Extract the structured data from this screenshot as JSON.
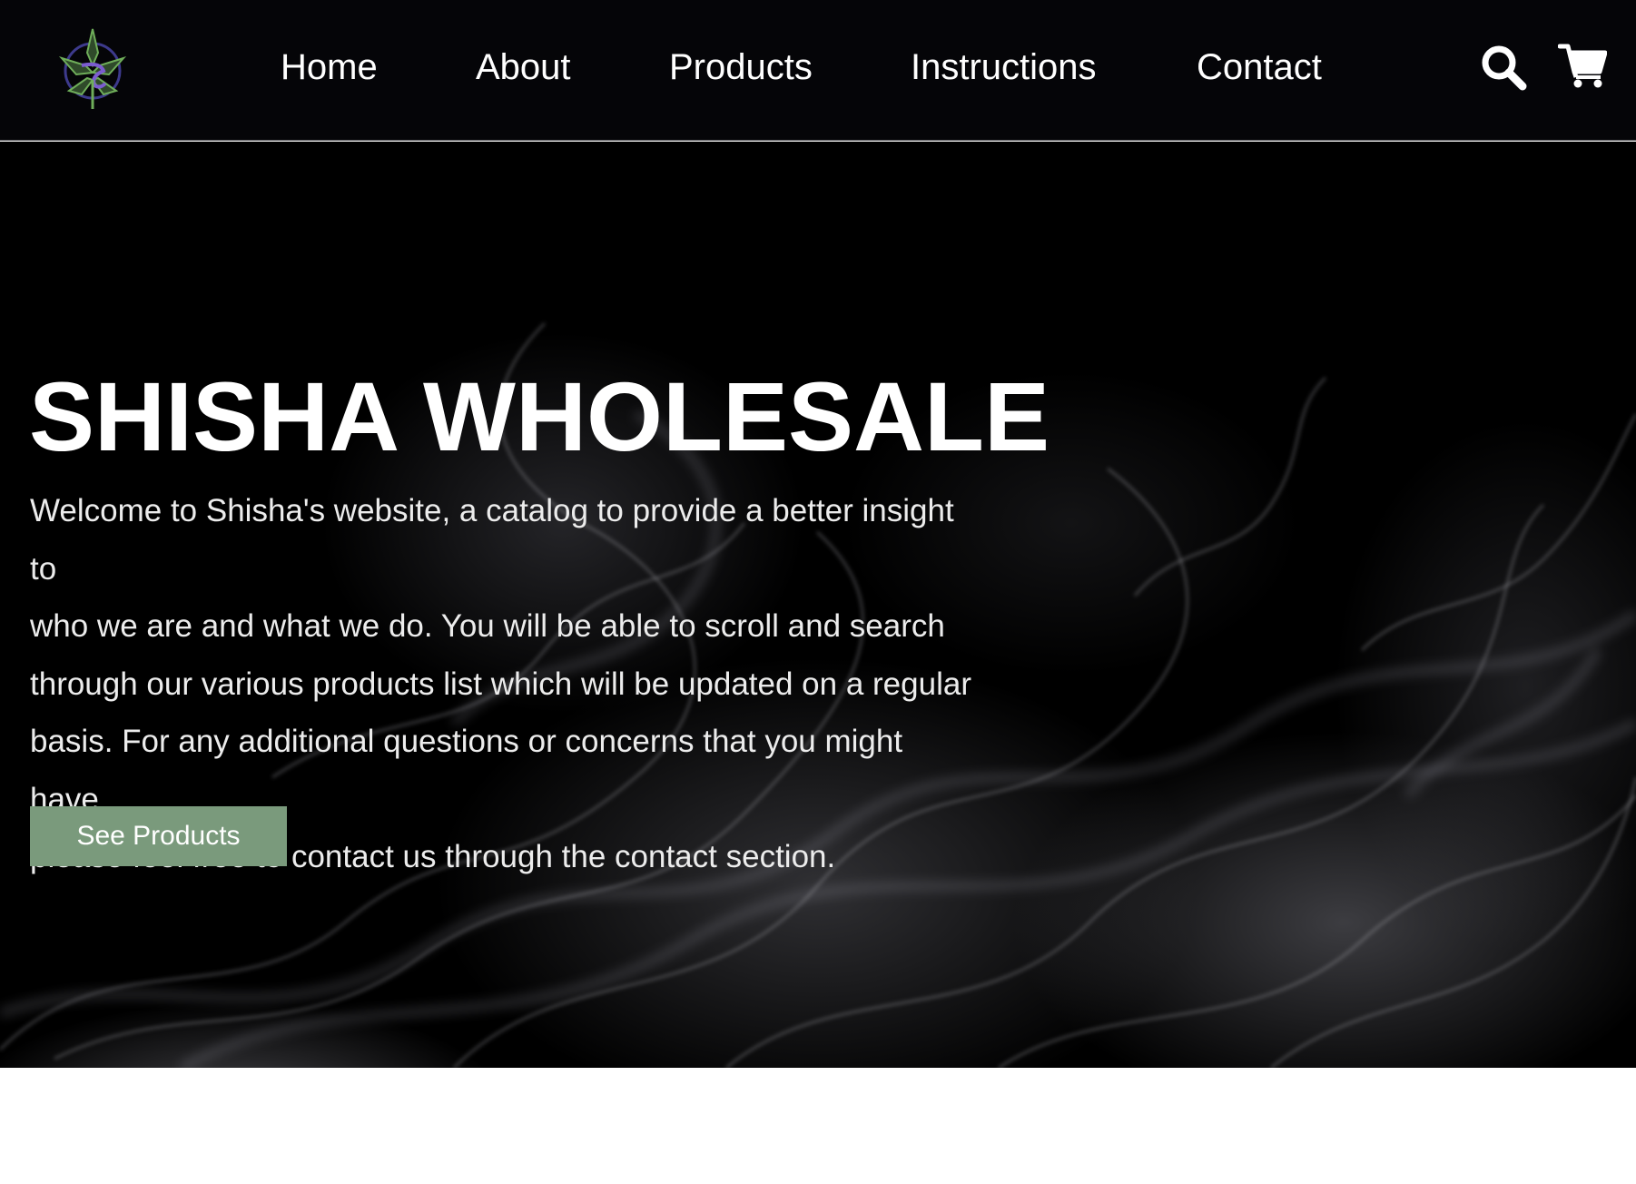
{
  "header": {
    "logo_icon": "leaf-emblem-logo",
    "nav": {
      "home": "Home",
      "about": "About",
      "products": "Products",
      "instructions": "Instructions",
      "contact": "Contact"
    },
    "search_icon": "search-icon",
    "cart_icon": "cart-icon"
  },
  "hero": {
    "title": "SHISHA WHOLESALE",
    "lines": [
      "Welcome to Shisha's website, a catalog to provide a better insight to",
      "who we are and what we do. You will be able to scroll and search",
      "through our various products list which will be updated on a regular",
      "basis. For any additional questions or concerns that you might have,",
      "please feel free to contact us through the contact section."
    ],
    "button_label": "See Products"
  },
  "colors": {
    "header_bg": "#050508",
    "hero_bg": "#000000",
    "button_bg": "#7a9a7c",
    "text": "#ffffff"
  }
}
